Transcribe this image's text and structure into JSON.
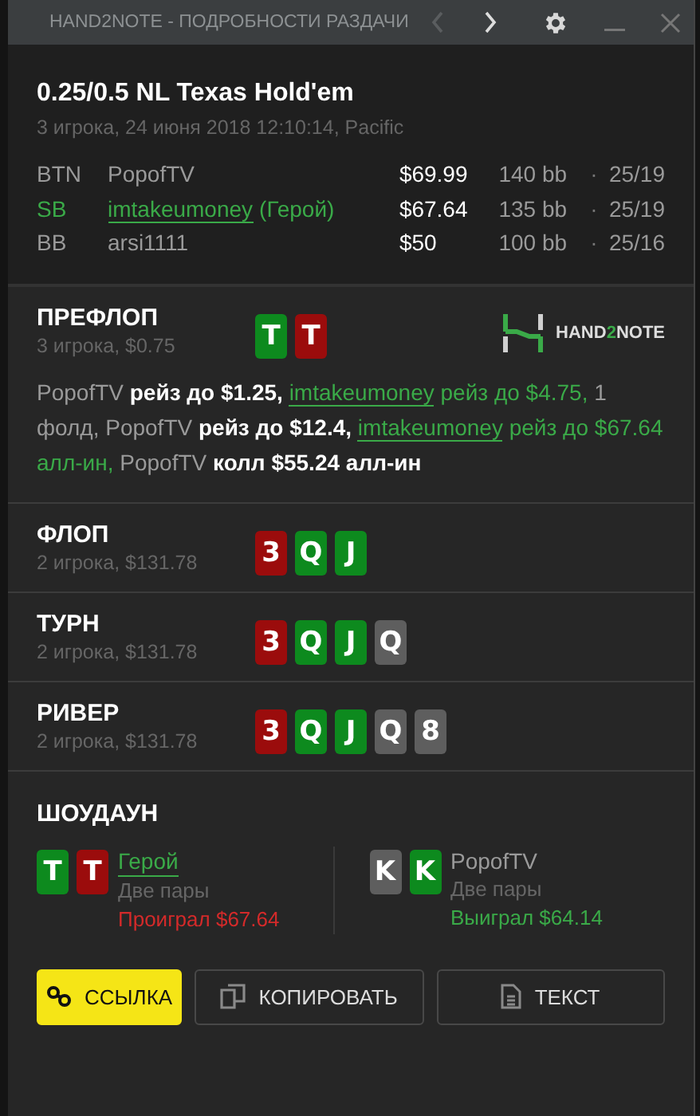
{
  "window": {
    "title": "HAND2NOTE - ПОДРОБНОСТИ РАЗДАЧИ",
    "nav": [
      {
        "kind": "prev",
        "disabled": true
      },
      {
        "kind": "next",
        "disabled": false
      }
    ]
  },
  "header": {
    "title": "0.25/0.5 NL Texas Hold'em",
    "subtitle": "3 игрока, 24 июня 2018 12:10:14, Pacific",
    "players": [
      {
        "position": "BTN",
        "name": "PopofTV",
        "hero": false,
        "stack": "$69.99",
        "bb": "140 bb",
        "sep": "·",
        "stats": "25/19"
      },
      {
        "position": "SB",
        "name": "imtakeumoney",
        "hero": true,
        "hero_tag": "(Герой)",
        "stack": "$67.64",
        "bb": "135 bb",
        "sep": "·",
        "stats": "25/19"
      },
      {
        "position": "BB",
        "name": "arsi1111",
        "hero": false,
        "stack": "$50",
        "bb": "100 bb",
        "sep": "·",
        "stats": "25/16"
      }
    ]
  },
  "streets": [
    {
      "title": "ПРЕФЛОП",
      "subtitle": "3 игрока, $0.75",
      "cards": [
        {
          "rank": "T",
          "color": "#0d8a1e"
        },
        {
          "rank": "T",
          "color": "#9b0c0c"
        }
      ],
      "logo": {
        "prefix": "HAND",
        "accent": "2",
        "suffix": "NOTE"
      },
      "actions": [
        {
          "kind": "player",
          "text": "PopofTV"
        },
        {
          "kind": "action",
          "text": "рейз до $1.25,"
        },
        {
          "kind": "hero",
          "text": "imtakeumoney"
        },
        {
          "kind": "hero_action",
          "text": "рейз до $4.75,"
        },
        {
          "kind": "player",
          "text": "1 фолд, PopofTV"
        },
        {
          "kind": "action",
          "text": "рейз до $12.4,"
        },
        {
          "kind": "hero",
          "text": "imtakeumoney"
        },
        {
          "kind": "hero_action",
          "text": "рейз до $67.64 алл-ин,"
        },
        {
          "kind": "player",
          "text": "PopofTV"
        },
        {
          "kind": "action",
          "text": "колл $55.24 алл-ин"
        }
      ]
    },
    {
      "title": "ФЛОП",
      "subtitle": "2 игрока, $131.78",
      "cards": [
        {
          "rank": "3",
          "color": "#9b0c0c"
        },
        {
          "rank": "Q",
          "color": "#0d8a1e"
        },
        {
          "rank": "J",
          "color": "#0d8a1e"
        }
      ]
    },
    {
      "title": "ТУРН",
      "subtitle": "2 игрока, $131.78",
      "cards": [
        {
          "rank": "3",
          "color": "#9b0c0c"
        },
        {
          "rank": "Q",
          "color": "#0d8a1e"
        },
        {
          "rank": "J",
          "color": "#0d8a1e"
        },
        {
          "rank": "Q",
          "color": "#5e5e5e"
        }
      ]
    },
    {
      "title": "РИВЕР",
      "subtitle": "2 игрока, $131.78",
      "cards": [
        {
          "rank": "3",
          "color": "#9b0c0c"
        },
        {
          "rank": "Q",
          "color": "#0d8a1e"
        },
        {
          "rank": "J",
          "color": "#0d8a1e"
        },
        {
          "rank": "Q",
          "color": "#5e5e5e"
        },
        {
          "rank": "8",
          "color": "#5e5e5e"
        }
      ]
    }
  ],
  "showdown": {
    "title": "ШОУДАУН",
    "players": [
      {
        "name": "Герой",
        "hero": true,
        "hand": "Две пары",
        "result": "Проиграл $67.64",
        "won": false,
        "cards": [
          {
            "rank": "T",
            "color": "#0d8a1e"
          },
          {
            "rank": "T",
            "color": "#9b0c0c"
          }
        ]
      },
      {
        "name": "PopofTV",
        "hero": false,
        "hand": "Две пары",
        "result": "Выиграл $64.14",
        "won": true,
        "cards": [
          {
            "rank": "K",
            "color": "#5e5e5e"
          },
          {
            "rank": "K",
            "color": "#0d8a1e"
          }
        ]
      }
    ]
  },
  "buttons": [
    {
      "kind": "link",
      "label": "ССЫЛКА",
      "primary": true
    },
    {
      "kind": "copy",
      "label": "КОПИРОВАТЬ",
      "primary": false
    },
    {
      "kind": "text",
      "label": "ТЕКСТ",
      "primary": false
    }
  ]
}
